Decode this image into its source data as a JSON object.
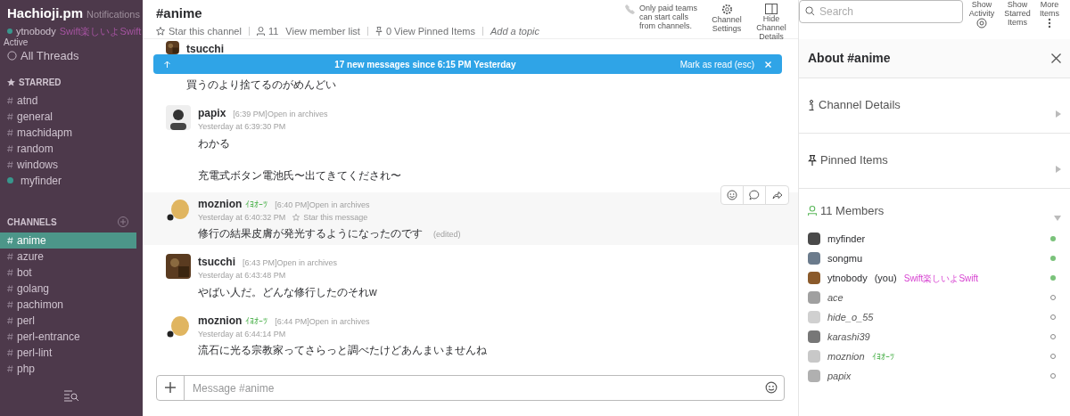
{
  "sidebar": {
    "team": "Hachioji.pm",
    "notifications": "Notifications",
    "user": {
      "name": "ytnobody",
      "status": "Swift楽しいよSwift",
      "online": true
    },
    "presence": "Active",
    "all_threads": "All Threads",
    "starred": {
      "title": "STARRED",
      "items": [
        {
          "label": "atnd",
          "kind": "channel",
          "selected": false
        },
        {
          "label": "general",
          "kind": "channel",
          "selected": false
        },
        {
          "label": "machidapm",
          "kind": "channel",
          "selected": false
        },
        {
          "label": "random",
          "kind": "channel",
          "selected": false
        },
        {
          "label": "windows",
          "kind": "channel",
          "selected": false
        },
        {
          "label": "myfinder",
          "kind": "dm",
          "selected": false
        }
      ]
    },
    "channels": {
      "title": "CHANNELS",
      "items": [
        {
          "label": "anime",
          "kind": "channel",
          "selected": true
        },
        {
          "label": "azure",
          "kind": "channel",
          "selected": false
        },
        {
          "label": "bot",
          "kind": "channel",
          "selected": false
        },
        {
          "label": "golang",
          "kind": "channel",
          "selected": false
        },
        {
          "label": "pachimon",
          "kind": "channel",
          "selected": false
        },
        {
          "label": "perl",
          "kind": "channel",
          "selected": false
        },
        {
          "label": "perl-entrance",
          "kind": "channel",
          "selected": false
        },
        {
          "label": "perl-lint",
          "kind": "channel",
          "selected": false
        },
        {
          "label": "php",
          "kind": "channel",
          "selected": false
        }
      ]
    }
  },
  "header": {
    "title": "#anime",
    "star": "Star this channel",
    "member_count": "11",
    "member_link": "View member list",
    "pinned": "0 View Pinned Items",
    "topic": "Add a topic",
    "calls_note": "Only paid teams can start calls from channels.",
    "settings": "Channel Settings",
    "details": "Hide Channel Details",
    "search_placeholder": "Search",
    "activity": "Show Activity",
    "starred": "Show Starred Items",
    "more": "More Items"
  },
  "banner": {
    "text": "17 new messages since 6:15 PM Yesterday",
    "action": "Mark as read (esc)"
  },
  "messages": [
    {
      "kind": "photo",
      "author": "tsucchi",
      "paragraphs": [
        "買うのより捨てるのがめんどい"
      ],
      "hovered": false
    },
    {
      "kind": "person",
      "author": "papix",
      "time": "[6:39 PM]",
      "archive": "Open in archives",
      "stamp": "Yesterday at 6:39:30 PM",
      "paragraphs": [
        "わかる",
        "充電式ボタン電池氏〜出てきてくだされ〜"
      ],
      "hovered": false
    },
    {
      "kind": "mascot",
      "author": "moznion",
      "badge": "ｲﾖｵｰﾂ",
      "time": "[6:40 PM]",
      "archive": "Open in archives",
      "stamp": "Yesterday at 6:40:32 PM",
      "paragraphs": [
        "修行の結果皮膚が発光するようになったのです"
      ],
      "edited": "(edited)",
      "star": "Star this message",
      "hovered": true
    },
    {
      "kind": "photo",
      "author": "tsucchi",
      "time": "[6:43 PM]",
      "archive": "Open in archives",
      "stamp": "Yesterday at 6:43:48 PM",
      "paragraphs": [
        "やばい人だ。どんな修行したのそれw"
      ],
      "hovered": false
    },
    {
      "kind": "mascot",
      "author": "moznion",
      "badge": "ｲﾖｵｰﾂ",
      "time": "[6:44 PM]",
      "archive": "Open in archives",
      "stamp": "Yesterday at 6:44:14 PM",
      "paragraphs": [
        "流石に光る宗教家ってさらっと調べたけどあんまいませんね"
      ],
      "hovered": false
    }
  ],
  "composer": {
    "placeholder": "Message #anime"
  },
  "details": {
    "title": "About #anime",
    "sections": [
      {
        "label": "Channel Details",
        "kind": "info"
      },
      {
        "label": "Pinned Items",
        "kind": "pin"
      }
    ],
    "members_title": "11 Members",
    "expanded": true,
    "members": [
      {
        "name": "myfinder",
        "online": true,
        "color": "#4a4a4a"
      },
      {
        "name": "songmu",
        "online": true,
        "color": "#6b7b8c"
      },
      {
        "name": "ytnobody",
        "you": "(you)",
        "status": "Swift楽しいよSwift",
        "online": true,
        "color": "#8b5a2b"
      },
      {
        "name": "ace",
        "online": false,
        "color": "#a0a0a0"
      },
      {
        "name": "hide_o_55",
        "online": false,
        "color": "#d0d0d0"
      },
      {
        "name": "karashi39",
        "online": false,
        "color": "#777777"
      },
      {
        "name": "moznion",
        "status": "ｲﾖｵｰﾂ",
        "online": false,
        "color": "#c8c8c8"
      },
      {
        "name": "papix",
        "online": false,
        "color": "#b0b0b0"
      }
    ]
  }
}
